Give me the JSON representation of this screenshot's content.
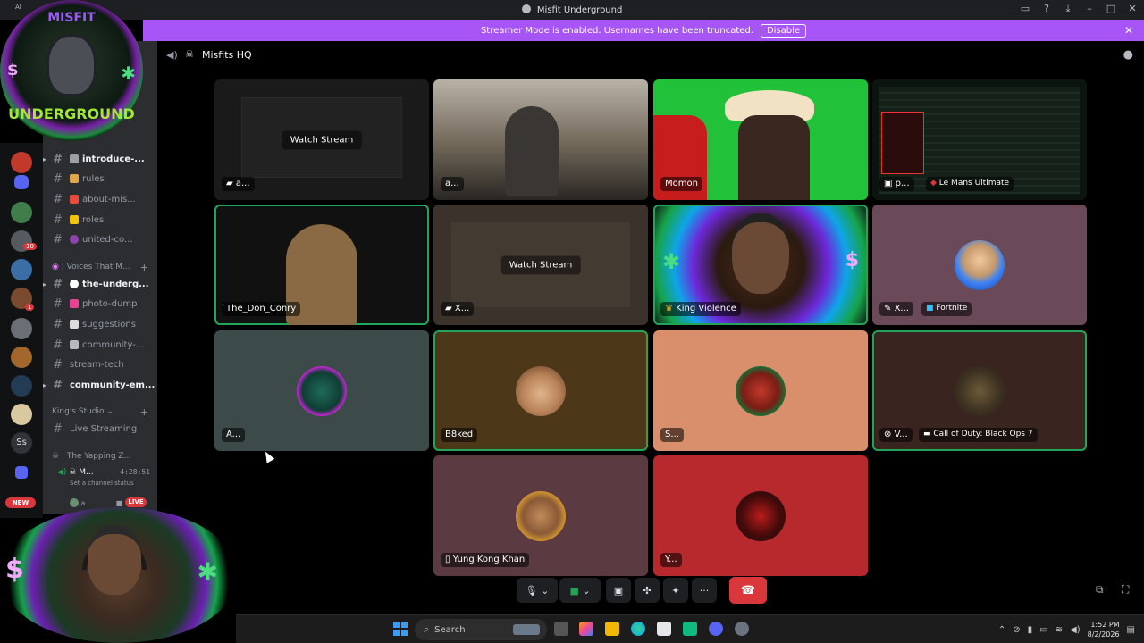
{
  "window": {
    "title": "Misfit Underground"
  },
  "banner": {
    "text": "Streamer Mode is enabled. Usernames have been truncated.",
    "button": "Disable"
  },
  "logo": {
    "line1": "MISFIT",
    "line2": "UNDERGROUND",
    "corner": "AI"
  },
  "header": {
    "channel": "Misfits HQ"
  },
  "sidebar": {
    "channels": [
      {
        "label": "introduce-...",
        "bold": true
      },
      {
        "label": "rules",
        "bold": false
      },
      {
        "label": "about-mis...",
        "bold": false
      },
      {
        "label": "roles",
        "bold": false
      },
      {
        "label": "united-co...",
        "bold": false
      }
    ],
    "category1": "| Voices That M...",
    "channels2": [
      {
        "label": "the-underg...",
        "bold": true
      },
      {
        "label": "photo-dump",
        "bold": false
      },
      {
        "label": "suggestions",
        "bold": false
      },
      {
        "label": "community-...",
        "bold": false
      },
      {
        "label": "stream-tech",
        "bold": false
      },
      {
        "label": "community-em...",
        "bold": true
      }
    ],
    "category2": "King's Studio",
    "live_streaming": "Live Streaming",
    "category3": "| The Yapping Z...",
    "voice_user": "M...",
    "voice_timer": "4:28:51",
    "voice_status": "Set a channel status",
    "sub_user": "a...",
    "live_badge": "LIVE",
    "new_badge": "NEW",
    "rail_letters": "Ss",
    "rail_badges": [
      "10",
      "1"
    ]
  },
  "tiles": [
    {
      "id": "t1",
      "label": "a...",
      "watch": "Watch Stream"
    },
    {
      "id": "t2",
      "label": "a..."
    },
    {
      "id": "t3",
      "label": "Momon"
    },
    {
      "id": "t4",
      "label": "p...",
      "game": "Le Mans Ultimate"
    },
    {
      "id": "t5",
      "label": "The_Don_Conry"
    },
    {
      "id": "t6",
      "label": "X...",
      "watch": "Watch Stream"
    },
    {
      "id": "t7",
      "label": "King Violence"
    },
    {
      "id": "t8",
      "label": "X...",
      "game": "Fortnite"
    },
    {
      "id": "t9",
      "label": "A..."
    },
    {
      "id": "t10",
      "label": "B8ked"
    },
    {
      "id": "t11",
      "label": "S..."
    },
    {
      "id": "t12",
      "label": "V...",
      "game": "Call of Duty: Black Ops 7"
    },
    {
      "id": "t13",
      "label": "Yung Kong Khan"
    },
    {
      "id": "t14",
      "label": "Y..."
    }
  ],
  "taskbar": {
    "search": "Search",
    "time": "1:52 PM",
    "date": "8/2/2026"
  },
  "colors": {
    "banner": "#a855f7",
    "speaking": "#23a559",
    "end_call": "#da373c",
    "live": "#da373c"
  }
}
